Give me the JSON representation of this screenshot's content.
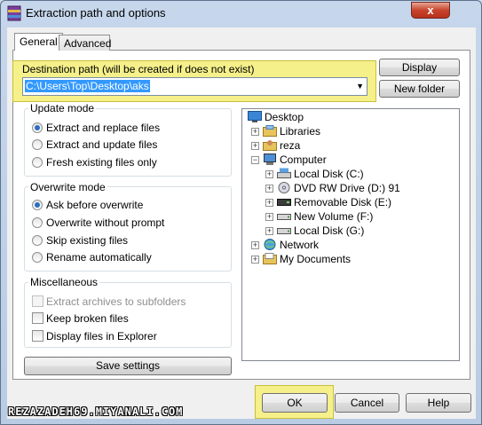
{
  "window": {
    "title": "Extraction path and options",
    "close_label": "x"
  },
  "tabs": [
    {
      "label": "General"
    },
    {
      "label": "Advanced"
    }
  ],
  "destination": {
    "label": "Destination path (will be created if does not exist)",
    "value": "C:\\Users\\Top\\Desktop\\aks"
  },
  "side_buttons": {
    "display": "Display",
    "new_folder": "New folder"
  },
  "update_mode": {
    "title": "Update mode",
    "options": [
      {
        "label": "Extract and replace files",
        "selected": true
      },
      {
        "label": "Extract and update files",
        "selected": false
      },
      {
        "label": "Fresh existing files only",
        "selected": false
      }
    ]
  },
  "overwrite_mode": {
    "title": "Overwrite mode",
    "options": [
      {
        "label": "Ask before overwrite",
        "selected": true
      },
      {
        "label": "Overwrite without prompt",
        "selected": false
      },
      {
        "label": "Skip existing files",
        "selected": false
      },
      {
        "label": "Rename automatically",
        "selected": false
      }
    ]
  },
  "miscellaneous": {
    "title": "Miscellaneous",
    "options": [
      {
        "label": "Extract archives to subfolders",
        "checked": false,
        "disabled": true
      },
      {
        "label": "Keep broken files",
        "checked": false,
        "disabled": false
      },
      {
        "label": "Display files in Explorer",
        "checked": false,
        "disabled": false
      }
    ]
  },
  "save_settings": "Save settings",
  "tree": [
    {
      "label": "Desktop",
      "icon": "desktop-icon"
    },
    {
      "label": "Libraries",
      "icon": "libraries-icon"
    },
    {
      "label": "reza",
      "icon": "user-folder-icon"
    },
    {
      "label": "Computer",
      "icon": "computer-icon"
    },
    {
      "label": "Local Disk (C:)",
      "icon": "local-disk-icon"
    },
    {
      "label": "DVD RW Drive (D:) 91",
      "icon": "dvd-drive-icon"
    },
    {
      "label": "Removable Disk (E:)",
      "icon": "removable-disk-icon"
    },
    {
      "label": "New Volume (F:)",
      "icon": "drive-icon"
    },
    {
      "label": "Local Disk (G:)",
      "icon": "drive-icon"
    },
    {
      "label": "Network",
      "icon": "network-icon"
    },
    {
      "label": "My Documents",
      "icon": "documents-folder-icon"
    }
  ],
  "footer": {
    "ok": "OK",
    "cancel": "Cancel",
    "help": "Help"
  },
  "watermark": "REZAZADEH69.MIYANALI.COM",
  "colors": {
    "highlight": "#f5f08a",
    "selection": "#3399ff",
    "close": "#c7432c"
  }
}
